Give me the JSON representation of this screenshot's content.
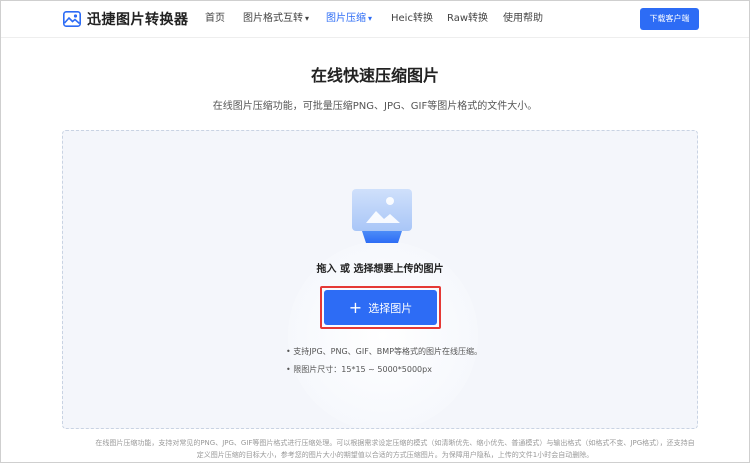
{
  "header": {
    "logo_text": "迅捷图片转换器",
    "nav": [
      {
        "label": "首页"
      },
      {
        "label": "图片格式互转",
        "chevron": "▾"
      },
      {
        "label": "图片压缩",
        "chevron": "▾"
      },
      {
        "label": "Heic转换"
      },
      {
        "label": "Raw转换"
      },
      {
        "label": "使用帮助"
      }
    ],
    "download_label": "下载客户端"
  },
  "main": {
    "title": "在线快速压缩图片",
    "subtitle": "在线图片压缩功能，可批量压缩PNG、JPG、GIF等图片格式的文件大小。",
    "upload": {
      "prompt": "拖入 或 选择想要上传的图片",
      "plus": "+",
      "button_label": "选择图片",
      "hint1": "• 支持JPG、PNG、GIF、BMP等格式的图片在线压缩。",
      "hint2": "• 限图片尺寸：15*15 ~ 5000*5000px"
    }
  },
  "footer": {
    "text": "在线图片压缩功能，支持对常见的PNG、JPG、GIF等图片格式进行压缩处理。可以根据需求设定压缩的模式（如清晰优先、缩小优先、普通模式）与输出格式（如格式不变、JPG格式），还支持自定义图片压缩的目标大小，参考您的图片大小的期望值以合适的方式压缩图片。为保障用户隐私，上传的文件1小时会自动删除。"
  },
  "colors": {
    "accent": "#2d6cf5",
    "highlight_border": "#e53935"
  },
  "icons": {
    "logo": "image-icon",
    "upload": "image-upload-icon"
  }
}
